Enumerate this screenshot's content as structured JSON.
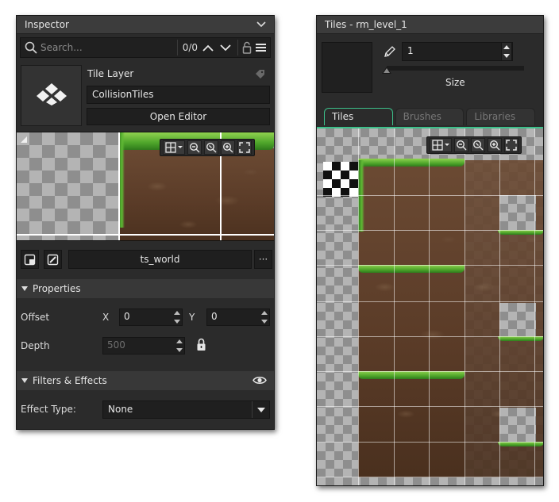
{
  "inspector": {
    "title": "Inspector",
    "search_placeholder": "Search...",
    "search_count": "0/0",
    "layer_type": "Tile Layer",
    "layer_name": "CollisionTiles",
    "open_editor_label": "Open Editor",
    "tileset_name": "ts_world",
    "more_label": "···",
    "properties_header": "Properties",
    "offset_label": "Offset",
    "x_label": "X",
    "x_value": "0",
    "y_label": "Y",
    "y_value": "0",
    "depth_label": "Depth",
    "depth_value": "500",
    "filters_header": "Filters & Effects",
    "effect_type_label": "Effect Type:",
    "effect_type_value": "None"
  },
  "tiles_panel": {
    "title": "Tiles - rm_level_1",
    "brush_size": "1",
    "size_label": "Size",
    "tabs": [
      {
        "label": "Tiles",
        "active": true
      },
      {
        "label": "Brushes",
        "active": false
      },
      {
        "label": "Libraries",
        "active": false
      }
    ]
  },
  "colors": {
    "panel_bg": "#2b2b2b",
    "accent_tab": "#3cc08a",
    "grass": "#5fb834",
    "dirt": "#5b3c28"
  },
  "icons": [
    "chevron-down-icon",
    "search-icon",
    "chevron-up-icon",
    "lock-icon",
    "hamburger-icon",
    "tile-layer-icon",
    "tag-icon",
    "grid-icon",
    "zoom-out-icon",
    "zoom-reset-icon",
    "zoom-in-icon",
    "fullscreen-icon",
    "new-tileset-icon",
    "edit-tileset-icon",
    "eye-icon",
    "pencil-icon"
  ]
}
